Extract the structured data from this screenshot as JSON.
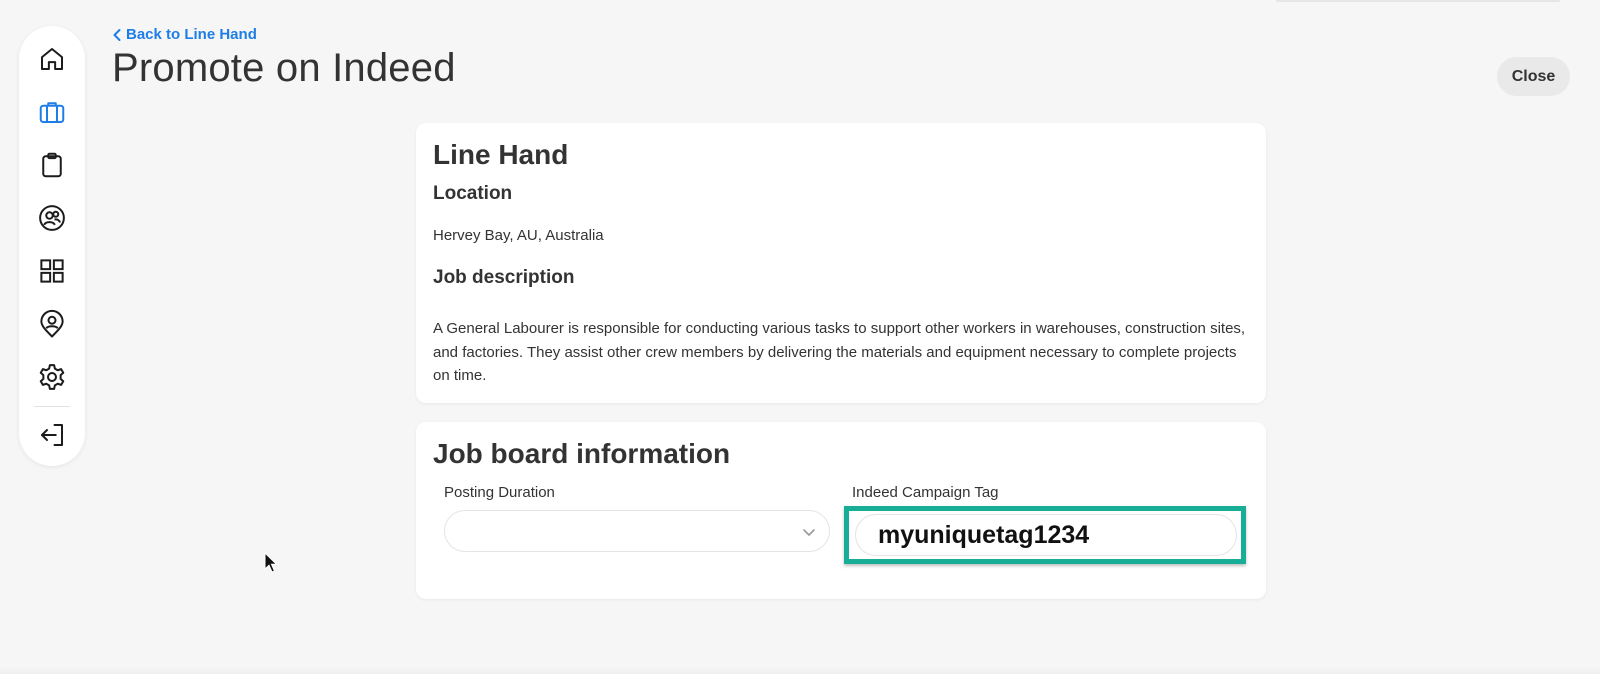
{
  "header": {
    "back_label": "Back to Line Hand",
    "title": "Promote on Indeed",
    "close_label": "Close"
  },
  "sidebar": {
    "items": [
      {
        "icon": "home-icon",
        "active": false
      },
      {
        "icon": "briefcase-icon",
        "active": true
      },
      {
        "icon": "clipboard-icon",
        "active": false
      },
      {
        "icon": "users-icon",
        "active": false
      },
      {
        "icon": "grid-icon",
        "active": false
      },
      {
        "icon": "user-pin-icon",
        "active": false
      },
      {
        "icon": "gear-icon",
        "active": false
      },
      {
        "icon": "logout-icon",
        "active": false
      }
    ]
  },
  "job": {
    "title": "Line Hand",
    "location_heading": "Location",
    "location": "Hervey Bay, AU, Australia",
    "description_heading": "Job description",
    "description": "A General Labourer is responsible for conducting various tasks to support other workers in warehouses, construction sites, and factories. They assist other crew members by delivering the materials and equipment necessary to complete projects on time."
  },
  "board": {
    "title": "Job board information",
    "duration_label": "Posting Duration",
    "duration_value": "",
    "tag_label": "Indeed Campaign Tag",
    "tag_value": "myuniquetag1234"
  },
  "colors": {
    "accent": "#1e7ee6",
    "highlight": "#18ad96"
  }
}
